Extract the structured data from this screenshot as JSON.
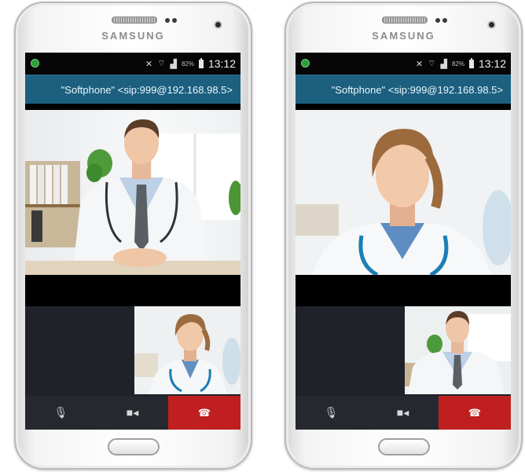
{
  "screens": [
    {
      "brand": "SAMSUNG",
      "status": {
        "battery": "82%",
        "time": "13:12"
      },
      "caller_id": "\"Softphone\" <sip:999@192.168.98.5>",
      "remote_party": "male doctor",
      "self_view": "female doctor",
      "controls": {
        "mic": "mic-icon",
        "video": "video-camera-icon",
        "end": "hang-up-icon",
        "end_color": "#c01f1f"
      }
    },
    {
      "brand": "SAMSUNG",
      "status": {
        "battery": "82%",
        "time": "13:12"
      },
      "caller_id": "\"Softphone\" <sip:999@192.168.98.5>",
      "remote_party": "female doctor",
      "self_view": "male doctor",
      "controls": {
        "mic": "mic-icon",
        "video": "video-camera-icon",
        "end": "hang-up-icon",
        "end_color": "#c01f1f"
      }
    }
  ],
  "colors": {
    "caller_bar": "#1c5f7f",
    "status_bar": "#060606",
    "control_bar": "#25292f",
    "end_call": "#c01f1f"
  }
}
